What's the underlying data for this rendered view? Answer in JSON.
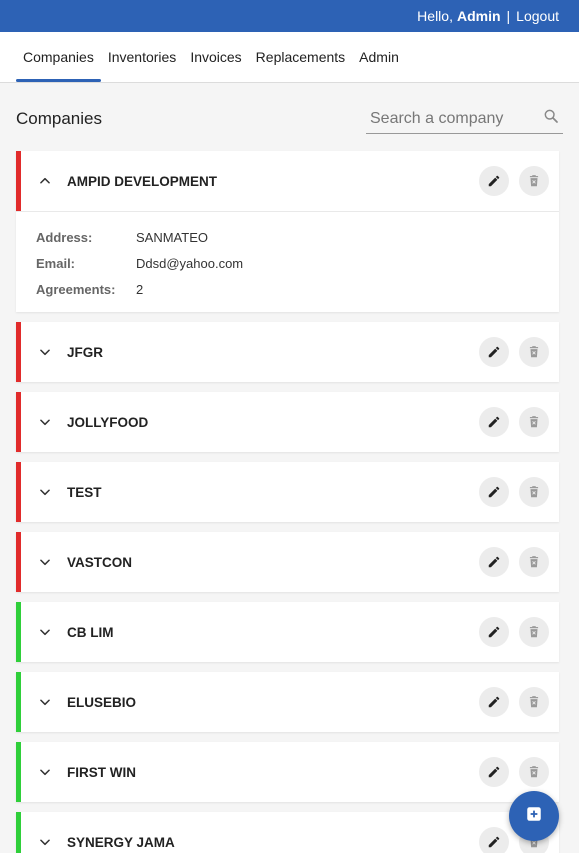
{
  "topbar": {
    "greeting": "Hello,",
    "user": "Admin",
    "separator": "|",
    "logout": "Logout"
  },
  "nav": {
    "tabs": [
      {
        "label": "Companies"
      },
      {
        "label": "Inventories"
      },
      {
        "label": "Invoices"
      },
      {
        "label": "Replacements"
      },
      {
        "label": "Admin"
      }
    ]
  },
  "page": {
    "title": "Companies",
    "search_placeholder": "Search a company"
  },
  "companies": [
    {
      "name": "AMPID DEVELOPMENT",
      "status_color": "#e12b2b",
      "expanded": true,
      "details": {
        "address_label": "Address:",
        "address": "SANMATEO",
        "email_label": "Email:",
        "email": "Ddsd@yahoo.com",
        "agreements_label": "Agreements:",
        "agreements": "2"
      }
    },
    {
      "name": "JFGR",
      "status_color": "#e12b2b"
    },
    {
      "name": "JOLLYFOOD",
      "status_color": "#e12b2b"
    },
    {
      "name": "TEST",
      "status_color": "#e12b2b"
    },
    {
      "name": "VASTCON",
      "status_color": "#e12b2b"
    },
    {
      "name": "CB LIM",
      "status_color": "#2fcf3a"
    },
    {
      "name": "ELUSEBIO",
      "status_color": "#2fcf3a"
    },
    {
      "name": "FIRST WIN",
      "status_color": "#2fcf3a"
    },
    {
      "name": "SYNERGY JAMA",
      "status_color": "#2fcf3a"
    }
  ],
  "icons": {
    "expand": "chevron-down-icon",
    "collapse": "chevron-up-icon",
    "edit": "pencil-icon",
    "delete": "trash-icon",
    "search": "search-icon",
    "add": "add-icon"
  },
  "colors": {
    "primary": "#2d62b5",
    "inactive": "#e12b2b",
    "active": "#2fcf3a"
  }
}
